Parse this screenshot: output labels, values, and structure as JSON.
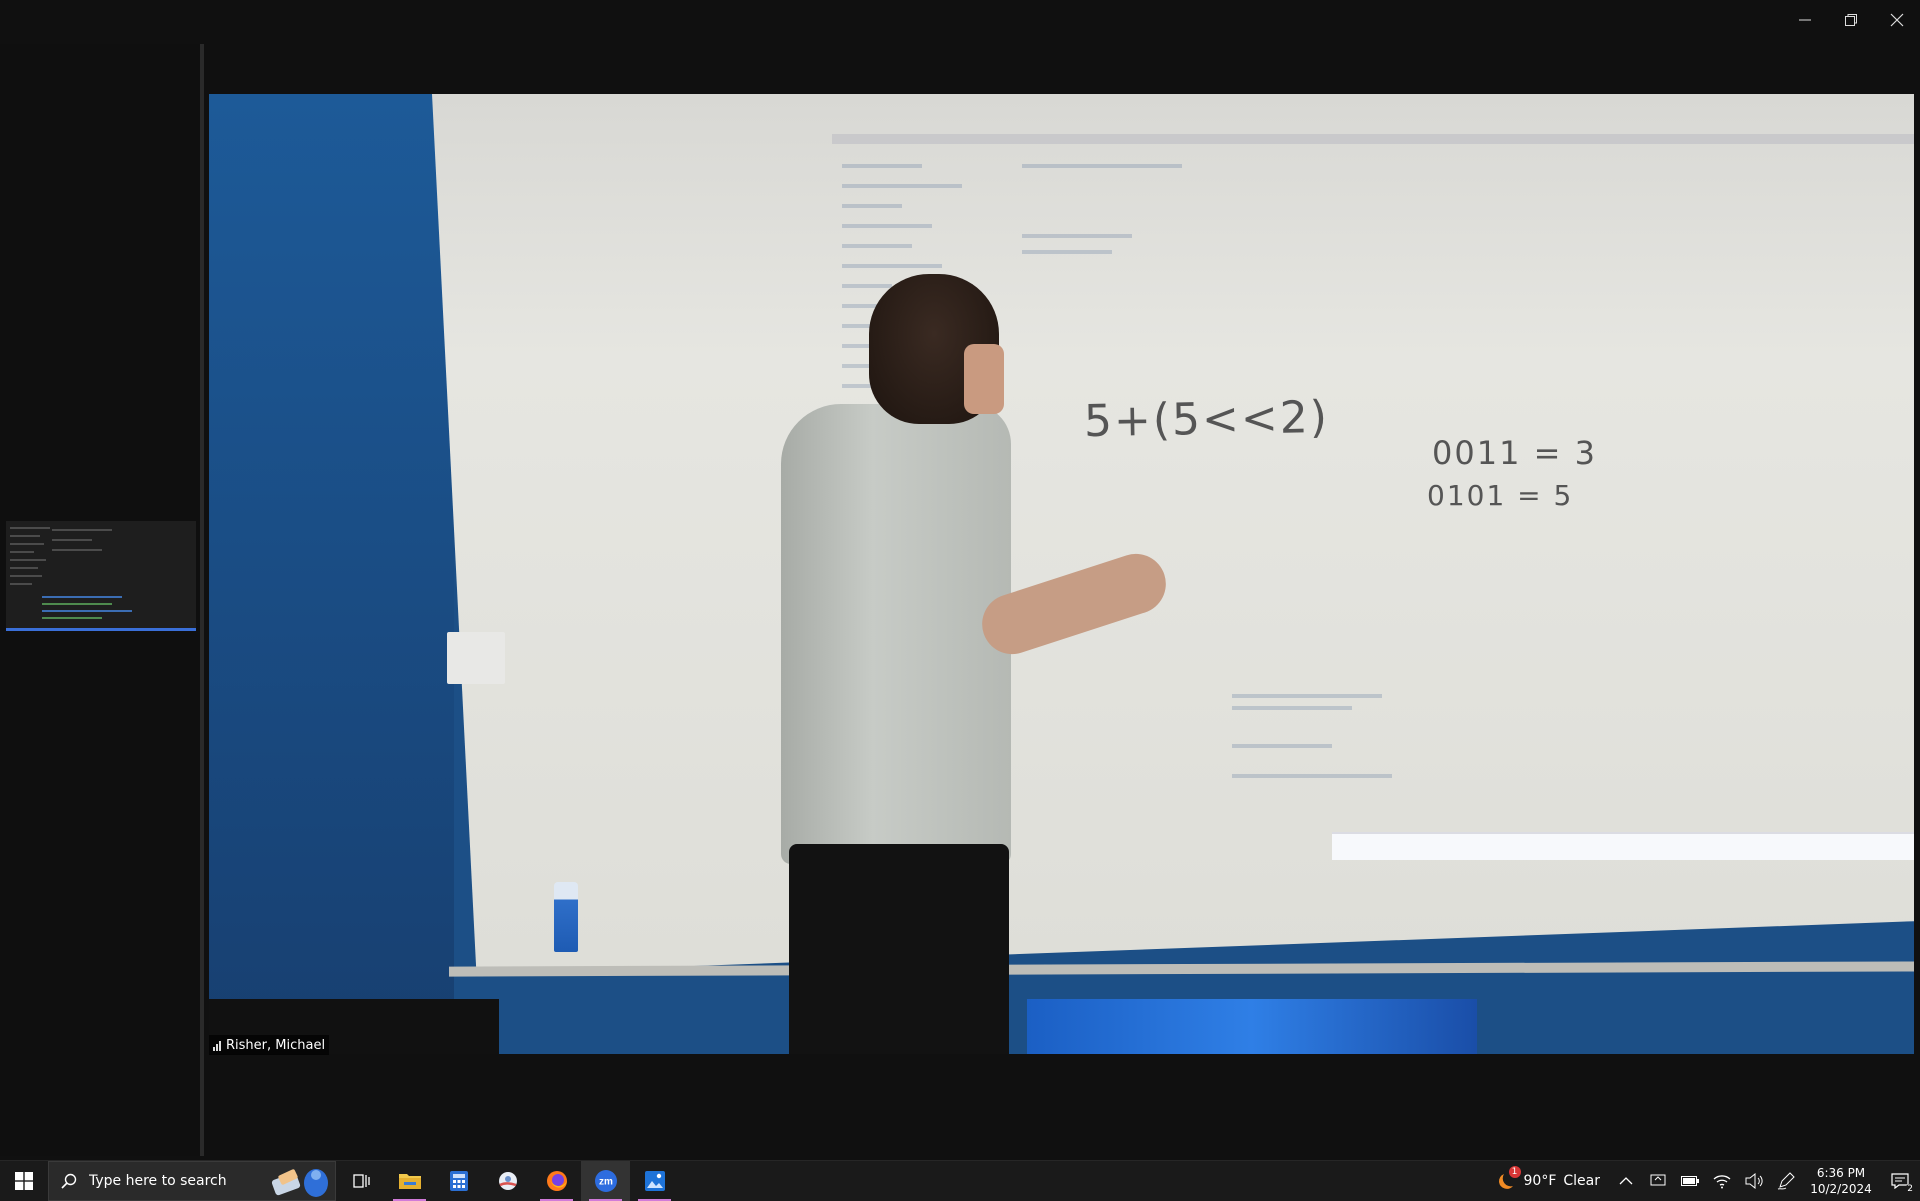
{
  "window": {
    "minimize_icon": "minimize-icon",
    "restore_icon": "restore-icon",
    "close_icon": "close-icon"
  },
  "video": {
    "participant_name": "Risher, Michael",
    "whiteboard": {
      "expression": "5+(5<<2)",
      "line1": "0011 = 3",
      "line2": "0101 = 5"
    }
  },
  "taskbar": {
    "search_placeholder": "Type here to search",
    "apps": [
      "task-view",
      "file-explorer",
      "calculator",
      "snipping-tool",
      "firefox",
      "zoom",
      "photos"
    ],
    "zoom_label": "zm",
    "weather": {
      "temp": "90°F",
      "condition": "Clear",
      "badge": "1"
    },
    "clock": {
      "time": "6:36 PM",
      "date": "10/2/2024"
    },
    "notification_count": "2"
  },
  "colors": {
    "accent": "#d17bd9",
    "zoom_blue": "#2d6cdf",
    "wall_blue": "#1d5a98"
  }
}
